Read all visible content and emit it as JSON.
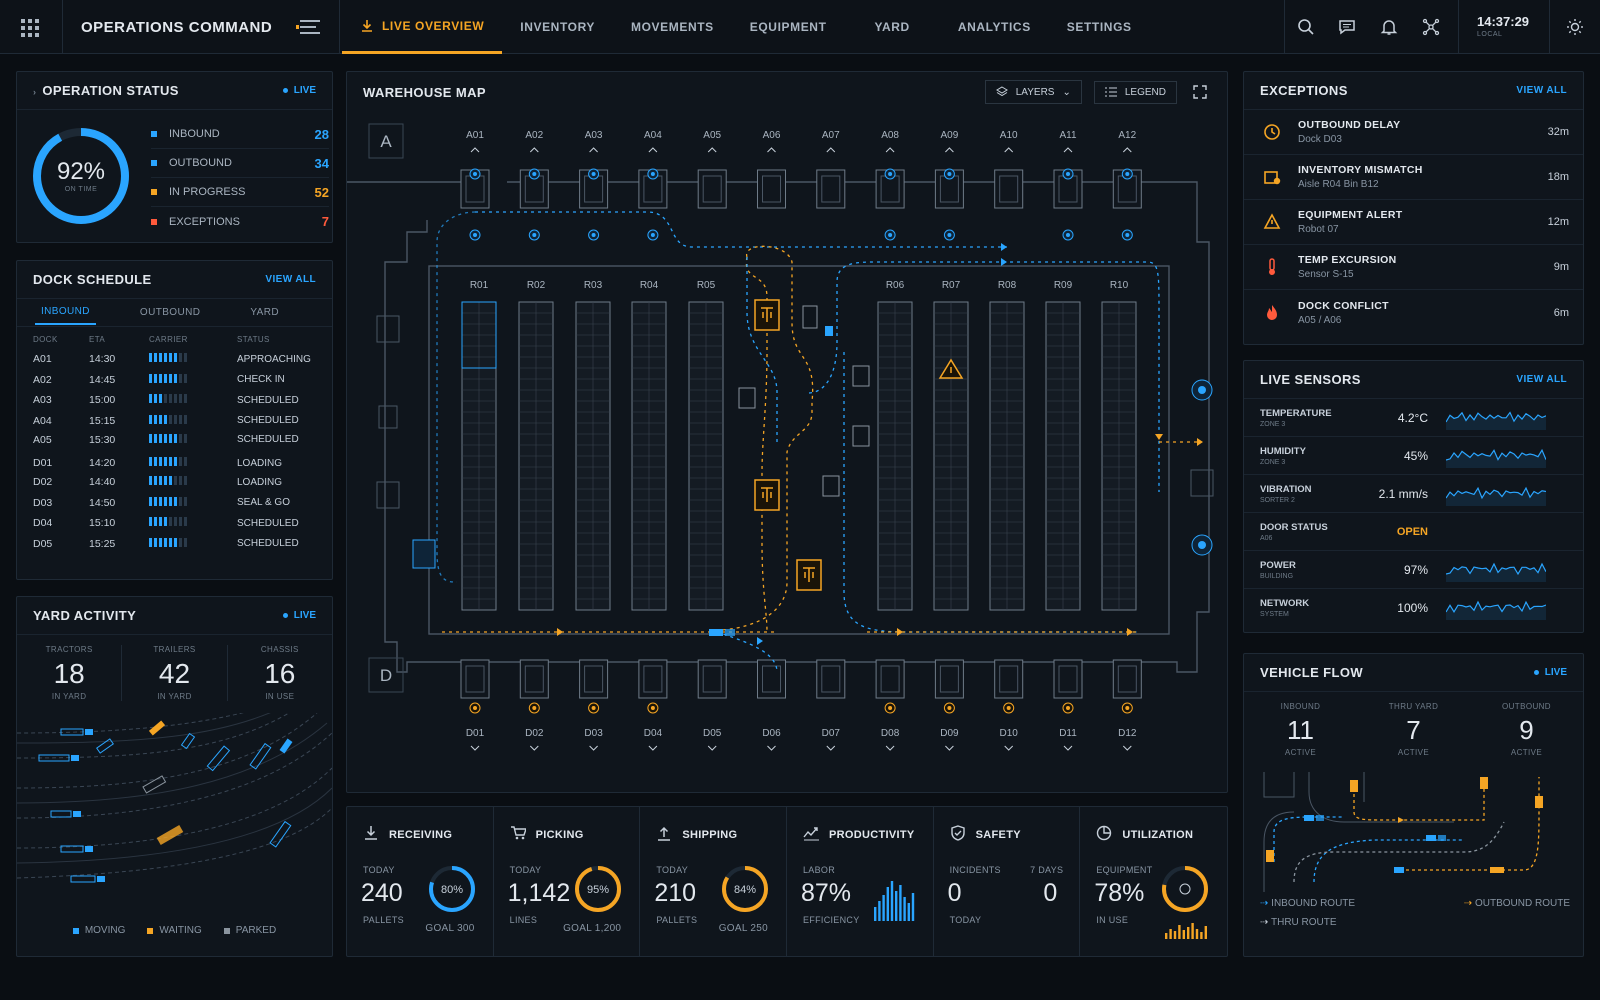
{
  "app": {
    "title": "OPERATIONS COMMAND"
  },
  "nav": {
    "tabs": [
      "LIVE OVERVIEW",
      "INVENTORY",
      "MOVEMENTS",
      "EQUIPMENT",
      "YARD",
      "ANALYTICS",
      "SETTINGS"
    ],
    "active": "LIVE OVERVIEW"
  },
  "clock": {
    "time": "14:37:29",
    "label": "LOCAL"
  },
  "icons": [
    "apps-grid-icon",
    "menu-icon",
    "search-icon",
    "chat-icon",
    "bell-icon",
    "network-icon",
    "theme-toggle-icon"
  ],
  "op_status": {
    "title": "OPERATION STATUS",
    "live": "LIVE",
    "percent": "92%",
    "percent_value": 0.92,
    "sub": "ON TIME",
    "rows": [
      {
        "label": "INBOUND",
        "value": "28",
        "color": "#2aa5ff"
      },
      {
        "label": "OUTBOUND",
        "value": "34",
        "color": "#2aa5ff"
      },
      {
        "label": "IN PROGRESS",
        "value": "52",
        "color": "#f5a524"
      },
      {
        "label": "EXCEPTIONS",
        "value": "7",
        "color": "#ff5a3c"
      }
    ]
  },
  "dock": {
    "title": "DOCK SCHEDULE",
    "link": "VIEW ALL",
    "tabs": [
      "INBOUND",
      "OUTBOUND",
      "YARD"
    ],
    "headers": [
      "DOCK",
      "ETA",
      "CARRIER",
      "STATUS"
    ],
    "rows": [
      {
        "dock": "A01",
        "eta": "14:30",
        "level": 6,
        "status": "APPROACHING"
      },
      {
        "dock": "A02",
        "eta": "14:45",
        "level": 6,
        "status": "CHECK IN"
      },
      {
        "dock": "A03",
        "eta": "15:00",
        "level": 3,
        "status": "SCHEDULED"
      },
      {
        "dock": "A04",
        "eta": "15:15",
        "level": 4,
        "status": "SCHEDULED"
      },
      {
        "dock": "A05",
        "eta": "15:30",
        "level": 6,
        "status": "SCHEDULED"
      },
      {
        "dock": "D01",
        "eta": "14:20",
        "level": 6,
        "status": "LOADING"
      },
      {
        "dock": "D02",
        "eta": "14:40",
        "level": 5,
        "status": "LOADING"
      },
      {
        "dock": "D03",
        "eta": "14:50",
        "level": 6,
        "status": "SEAL & GO"
      },
      {
        "dock": "D04",
        "eta": "15:10",
        "level": 4,
        "status": "SCHEDULED"
      },
      {
        "dock": "D05",
        "eta": "15:25",
        "level": 6,
        "status": "SCHEDULED"
      }
    ]
  },
  "yard": {
    "title": "YARD ACTIVITY",
    "live": "LIVE",
    "stats": [
      {
        "label": "TRACTORS",
        "value": "18",
        "sub": "IN YARD"
      },
      {
        "label": "TRAILERS",
        "value": "42",
        "sub": "IN YARD"
      },
      {
        "label": "CHASSIS",
        "value": "16",
        "sub": "IN USE"
      }
    ],
    "legend": [
      {
        "label": "MOVING",
        "color": "#2aa5ff"
      },
      {
        "label": "WAITING",
        "color": "#f5a524"
      },
      {
        "label": "PARKED",
        "color": "#8a949e"
      }
    ]
  },
  "map": {
    "title": "WAREHOUSE MAP",
    "layers_label": "LAYERS",
    "legend_label": "LEGEND",
    "zone_top": "A",
    "zone_bottom": "D",
    "docks_top": [
      "A01",
      "A02",
      "A03",
      "A04",
      "A05",
      "A06",
      "A07",
      "A08",
      "A09",
      "A10",
      "A11",
      "A12"
    ],
    "docks_bottom": [
      "D01",
      "D02",
      "D03",
      "D04",
      "D05",
      "D06",
      "D07",
      "D08",
      "D09",
      "D10",
      "D11",
      "D12"
    ],
    "racks": [
      "R01",
      "R02",
      "R03",
      "R04",
      "R05",
      "R06",
      "R07",
      "R08",
      "R09",
      "R10"
    ]
  },
  "kpis": [
    {
      "title": "RECEIVING",
      "icon": "download-icon",
      "small_top": "TODAY",
      "big": "240",
      "small_bottom": "PALLETS",
      "ring": "80%",
      "ring_value": 0.8,
      "ring_color": "#2aa5ff",
      "goal": "GOAL 300"
    },
    {
      "title": "PICKING",
      "icon": "cart-icon",
      "small_top": "TODAY",
      "big": "1,142",
      "small_bottom": "LINES",
      "ring": "95%",
      "ring_value": 0.95,
      "ring_color": "#f5a524",
      "goal": "GOAL 1,200"
    },
    {
      "title": "SHIPPING",
      "icon": "upload-icon",
      "small_top": "TODAY",
      "big": "210",
      "small_bottom": "PALLETS",
      "ring": "84%",
      "ring_value": 0.84,
      "ring_color": "#f5a524",
      "goal": "GOAL 250"
    },
    {
      "title": "PRODUCTIVITY",
      "icon": "trend-icon",
      "small_top": "LABOR",
      "big": "87%",
      "small_bottom": "EFFICIENCY"
    },
    {
      "title": "SAFETY",
      "icon": "shield-icon",
      "small_top": "INCIDENTS",
      "big": "0",
      "small_bottom": "TODAY",
      "small_top2": "7 DAYS",
      "big2": "0"
    },
    {
      "title": "UTILIZATION",
      "icon": "pie-icon",
      "small_top": "EQUIPMENT",
      "big": "78%",
      "small_bottom": "IN USE",
      "ring_value": 0.78,
      "ring_color": "#f5a524"
    }
  ],
  "exceptions": {
    "title": "EXCEPTIONS",
    "link": "VIEW ALL",
    "items": [
      {
        "title": "OUTBOUND DELAY",
        "sub": "Dock D03",
        "time": "32m",
        "icon": "clock-alert-icon",
        "color": "#f5a524"
      },
      {
        "title": "INVENTORY MISMATCH",
        "sub": "Aisle R04  Bin B12",
        "time": "18m",
        "icon": "box-alert-icon",
        "color": "#f5a524"
      },
      {
        "title": "EQUIPMENT ALERT",
        "sub": "Robot 07",
        "time": "12m",
        "icon": "robot-alert-icon",
        "color": "#f5a524"
      },
      {
        "title": "TEMP EXCURSION",
        "sub": "Sensor S-15",
        "time": "9m",
        "icon": "thermometer-icon",
        "color": "#ff5a3c"
      },
      {
        "title": "DOCK CONFLICT",
        "sub": "A05 / A06",
        "time": "6m",
        "icon": "fire-icon",
        "color": "#ff5a3c"
      }
    ]
  },
  "sensors": {
    "title": "LIVE SENSORS",
    "link": "VIEW ALL",
    "rows": [
      {
        "name": "TEMPERATURE",
        "sub": "ZONE 3",
        "value": "4.2°C"
      },
      {
        "name": "HUMIDITY",
        "sub": "ZONE 3",
        "value": "45%"
      },
      {
        "name": "VIBRATION",
        "sub": "SORTER 2",
        "value": "2.1 mm/s"
      },
      {
        "name": "DOOR STATUS",
        "sub": "A06",
        "value": "OPEN",
        "accent": "#f5a524"
      },
      {
        "name": "POWER",
        "sub": "BUILDING",
        "value": "97%"
      },
      {
        "name": "NETWORK",
        "sub": "SYSTEM",
        "value": "100%"
      }
    ]
  },
  "vehicle_flow": {
    "title": "VEHICLE FLOW",
    "live": "LIVE",
    "stats": [
      {
        "label": "INBOUND",
        "value": "11",
        "sub": "ACTIVE"
      },
      {
        "label": "THRU YARD",
        "value": "7",
        "sub": "ACTIVE"
      },
      {
        "label": "OUTBOUND",
        "value": "9",
        "sub": "ACTIVE"
      }
    ],
    "legend": [
      {
        "label": "INBOUND ROUTE",
        "color": "#2aa5ff"
      },
      {
        "label": "OUTBOUND ROUTE",
        "color": "#f5a524"
      },
      {
        "label": "THRU ROUTE",
        "color": "#c7d0da"
      }
    ]
  }
}
